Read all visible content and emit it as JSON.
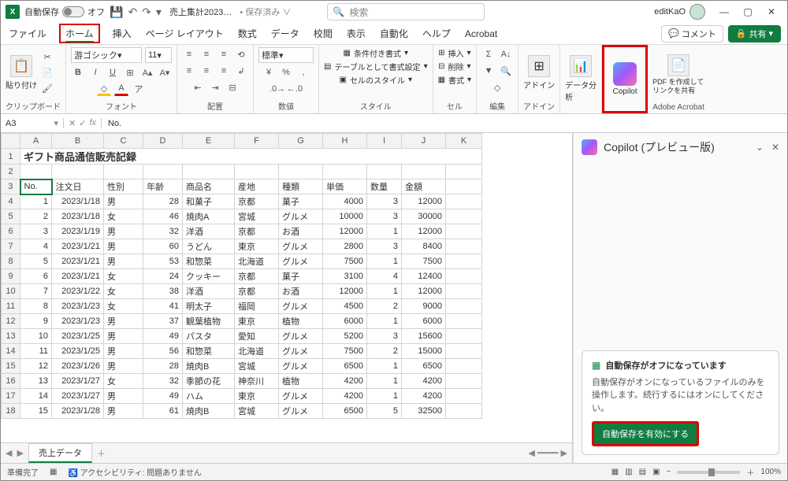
{
  "titlebar": {
    "autosave_label": "自動保存",
    "autosave_state": "オフ",
    "filename": "売上集計2023…",
    "saved_indicator": "保存済み",
    "search_placeholder": "検索",
    "user_name": "editKaO"
  },
  "tabs": {
    "items": [
      "ファイル",
      "ホーム",
      "挿入",
      "ページ レイアウト",
      "数式",
      "データ",
      "校閲",
      "表示",
      "自動化",
      "ヘルプ",
      "Acrobat"
    ],
    "comment_btn": "コメント",
    "share_btn": "共有"
  },
  "ribbon": {
    "clipboard": {
      "paste": "貼り付け",
      "label": "クリップボード"
    },
    "font": {
      "name": "游ゴシック",
      "size": "11",
      "label": "フォント"
    },
    "alignment": {
      "label": "配置"
    },
    "number": {
      "format": "標準",
      "label": "数値"
    },
    "styles": {
      "cond": "条件付き書式",
      "table": "テーブルとして書式設定",
      "cell": "セルのスタイル",
      "label": "スタイル"
    },
    "cells": {
      "insert": "挿入",
      "delete": "削除",
      "format": "書式",
      "label": "セル"
    },
    "editing": {
      "label": "編集"
    },
    "addins": {
      "addin": "アドイン",
      "label": "アドイン"
    },
    "analysis": {
      "btn": "データ分析"
    },
    "copilot": "Copilot",
    "acrobat": {
      "btn": "PDF を作成してリンクを共有",
      "label": "Adobe Acrobat"
    }
  },
  "formula_bar": {
    "cell_ref": "A3",
    "value": "No."
  },
  "sheet": {
    "columns": [
      "A",
      "B",
      "C",
      "D",
      "E",
      "F",
      "G",
      "H",
      "I",
      "J",
      "K"
    ],
    "title": "ギフト商品通信販売記録",
    "headers": [
      "No.",
      "注文日",
      "性別",
      "年齢",
      "商品名",
      "産地",
      "種類",
      "単価",
      "数量",
      "金額"
    ],
    "rows": [
      {
        "no": 1,
        "date": "2023/1/18",
        "sex": "男",
        "age": 28,
        "item": "和菓子",
        "place": "京都",
        "type": "菓子",
        "price": 4000,
        "qty": 3,
        "amt": 12000
      },
      {
        "no": 2,
        "date": "2023/1/18",
        "sex": "女",
        "age": 46,
        "item": "焼肉A",
        "place": "宮城",
        "type": "グルメ",
        "price": 10000,
        "qty": 3,
        "amt": 30000
      },
      {
        "no": 3,
        "date": "2023/1/19",
        "sex": "男",
        "age": 32,
        "item": "洋酒",
        "place": "京都",
        "type": "お酒",
        "price": 12000,
        "qty": 1,
        "amt": 12000
      },
      {
        "no": 4,
        "date": "2023/1/21",
        "sex": "男",
        "age": 60,
        "item": "うどん",
        "place": "東京",
        "type": "グルメ",
        "price": 2800,
        "qty": 3,
        "amt": 8400
      },
      {
        "no": 5,
        "date": "2023/1/21",
        "sex": "男",
        "age": 53,
        "item": "和惣菜",
        "place": "北海道",
        "type": "グルメ",
        "price": 7500,
        "qty": 1,
        "amt": 7500
      },
      {
        "no": 6,
        "date": "2023/1/21",
        "sex": "女",
        "age": 24,
        "item": "クッキー",
        "place": "京都",
        "type": "菓子",
        "price": 3100,
        "qty": 4,
        "amt": 12400
      },
      {
        "no": 7,
        "date": "2023/1/22",
        "sex": "女",
        "age": 38,
        "item": "洋酒",
        "place": "京都",
        "type": "お酒",
        "price": 12000,
        "qty": 1,
        "amt": 12000
      },
      {
        "no": 8,
        "date": "2023/1/23",
        "sex": "女",
        "age": 41,
        "item": "明太子",
        "place": "福岡",
        "type": "グルメ",
        "price": 4500,
        "qty": 2,
        "amt": 9000
      },
      {
        "no": 9,
        "date": "2023/1/23",
        "sex": "男",
        "age": 37,
        "item": "観葉植物",
        "place": "東京",
        "type": "植物",
        "price": 6000,
        "qty": 1,
        "amt": 6000
      },
      {
        "no": 10,
        "date": "2023/1/25",
        "sex": "男",
        "age": 49,
        "item": "パスタ",
        "place": "愛知",
        "type": "グルメ",
        "price": 5200,
        "qty": 3,
        "amt": 15600
      },
      {
        "no": 11,
        "date": "2023/1/25",
        "sex": "男",
        "age": 56,
        "item": "和惣菜",
        "place": "北海道",
        "type": "グルメ",
        "price": 7500,
        "qty": 2,
        "amt": 15000
      },
      {
        "no": 12,
        "date": "2023/1/26",
        "sex": "男",
        "age": 28,
        "item": "焼肉B",
        "place": "宮城",
        "type": "グルメ",
        "price": 6500,
        "qty": 1,
        "amt": 6500
      },
      {
        "no": 13,
        "date": "2023/1/27",
        "sex": "女",
        "age": 32,
        "item": "季節の花",
        "place": "神奈川",
        "type": "植物",
        "price": 4200,
        "qty": 1,
        "amt": 4200
      },
      {
        "no": 14,
        "date": "2023/1/27",
        "sex": "男",
        "age": 49,
        "item": "ハム",
        "place": "東京",
        "type": "グルメ",
        "price": 4200,
        "qty": 1,
        "amt": 4200
      },
      {
        "no": 15,
        "date": "2023/1/28",
        "sex": "男",
        "age": 61,
        "item": "焼肉B",
        "place": "宮城",
        "type": "グルメ",
        "price": 6500,
        "qty": 5,
        "amt": 32500
      }
    ],
    "tab_name": "売上データ"
  },
  "copilot_pane": {
    "title": "Copilot (プレビュー版)",
    "card_title": "自動保存がオフになっています",
    "card_msg": "自動保存がオンになっているファイルのみを操作します。続行するにはオンにしてください。",
    "card_btn": "自動保存を有効にする"
  },
  "statusbar": {
    "ready": "準備完了",
    "accessibility": "アクセシビリティ: 問題ありません",
    "zoom": "100%"
  }
}
